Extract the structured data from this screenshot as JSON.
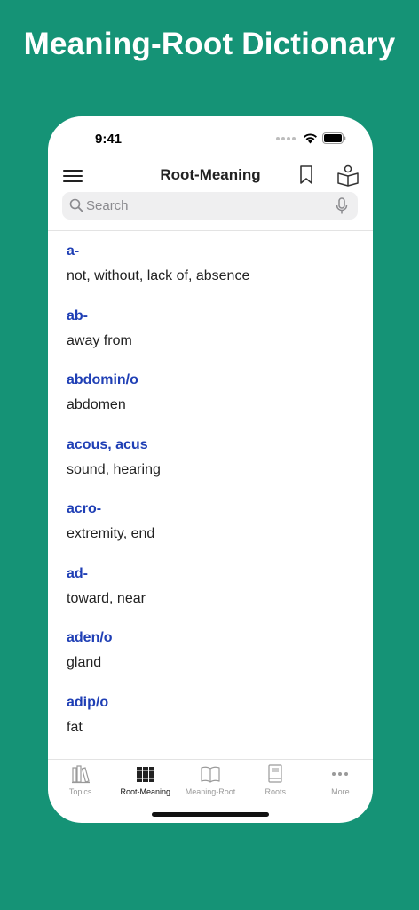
{
  "promo": {
    "title": "Meaning-Root Dictionary"
  },
  "status": {
    "time": "9:41"
  },
  "nav": {
    "title": "Root-Meaning"
  },
  "search": {
    "placeholder": "Search",
    "value": ""
  },
  "entries": [
    {
      "root": "a-",
      "meaning": "not, without, lack of, absence"
    },
    {
      "root": "ab-",
      "meaning": "away from"
    },
    {
      "root": "abdomin/o",
      "meaning": "abdomen"
    },
    {
      "root": "acous, acus",
      "meaning": "sound, hearing"
    },
    {
      "root": "acro-",
      "meaning": "extremity, end"
    },
    {
      "root": "ad-",
      "meaning": "toward, near"
    },
    {
      "root": "aden/o",
      "meaning": "gland"
    },
    {
      "root": "adip/o",
      "meaning": "fat"
    }
  ],
  "tabs": [
    {
      "label": "Topics",
      "icon": "books-icon",
      "active": false
    },
    {
      "label": "Root-Meaning",
      "icon": "books-icon",
      "active": true
    },
    {
      "label": "Meaning-Root",
      "icon": "open-book-icon",
      "active": false
    },
    {
      "label": "Roots",
      "icon": "book-icon",
      "active": false
    },
    {
      "label": "More",
      "icon": "more-icon",
      "active": false
    }
  ],
  "colors": {
    "background": "#159376",
    "root_text": "#1f3fb5",
    "tab_inactive": "#9a9a9a",
    "tab_active": "#111111"
  }
}
